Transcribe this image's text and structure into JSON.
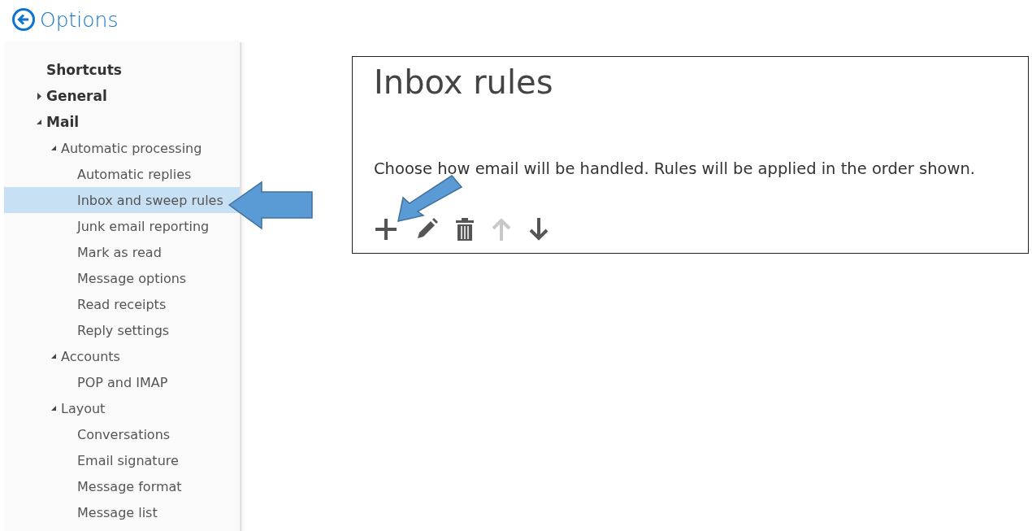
{
  "header": {
    "title": "Options"
  },
  "sidebar": {
    "items": [
      {
        "label": "Shortcuts",
        "selected": false
      },
      {
        "label": "General",
        "expanded": false,
        "selected": false
      },
      {
        "label": "Mail",
        "expanded": true,
        "selected": false,
        "children": [
          {
            "label": "Automatic processing",
            "expanded": true,
            "selected": false,
            "children": [
              {
                "label": "Automatic replies",
                "selected": false
              },
              {
                "label": "Inbox and sweep rules",
                "selected": true
              },
              {
                "label": "Junk email reporting",
                "selected": false
              },
              {
                "label": "Mark as read",
                "selected": false
              },
              {
                "label": "Message options",
                "selected": false
              },
              {
                "label": "Read receipts",
                "selected": false
              },
              {
                "label": "Reply settings",
                "selected": false
              }
            ]
          },
          {
            "label": "Accounts",
            "expanded": true,
            "selected": false,
            "children": [
              {
                "label": "POP and IMAP",
                "selected": false
              }
            ]
          },
          {
            "label": "Layout",
            "expanded": true,
            "selected": false,
            "children": [
              {
                "label": "Conversations",
                "selected": false
              },
              {
                "label": "Email signature",
                "selected": false
              },
              {
                "label": "Message format",
                "selected": false
              },
              {
                "label": "Message list",
                "selected": false
              }
            ]
          }
        ]
      }
    ]
  },
  "panel": {
    "title": "Inbox rules",
    "description": "Choose how email will be handled. Rules will be applied in the order shown.",
    "toolbar": [
      {
        "kind": "add",
        "disabled": false
      },
      {
        "kind": "edit",
        "disabled": false
      },
      {
        "kind": "delete",
        "disabled": false
      },
      {
        "kind": "move-up",
        "disabled": true
      },
      {
        "kind": "move-down",
        "disabled": false
      }
    ]
  }
}
